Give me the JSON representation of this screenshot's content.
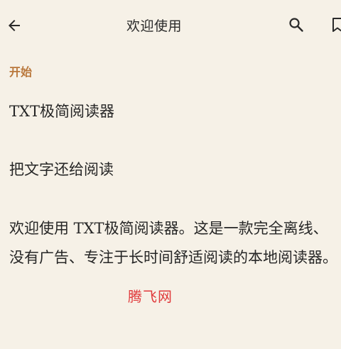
{
  "header": {
    "title": "欢迎使用",
    "icons": [
      "back-arrow-icon",
      "search-icon",
      "bookmark-icon"
    ]
  },
  "content": {
    "section_label": "开始",
    "book_title": "TXT极简阅读器",
    "subtitle": "把文字还给阅读",
    "body": "欢迎使用 TXT极简阅读器。这是一款完全离线、没有广告、专注于长时间舒适阅读的本地阅读器。"
  },
  "watermark": {
    "text": "腾飞网"
  },
  "colors": {
    "background": "#f6f1e7",
    "accent": "#b9773b",
    "text": "#262626",
    "watermark": "#e0393b"
  }
}
